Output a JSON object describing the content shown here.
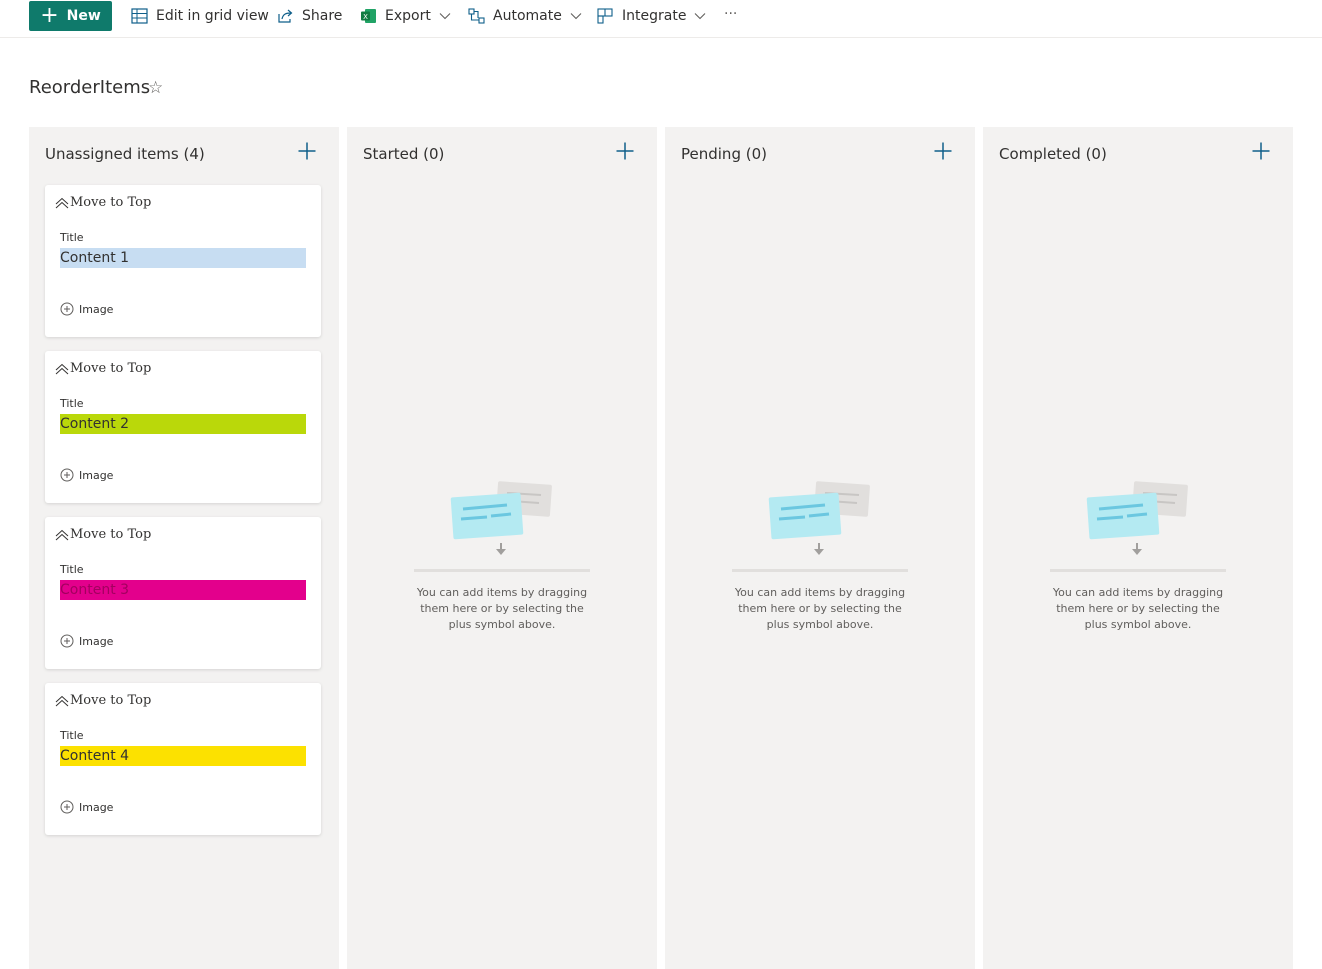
{
  "toolbar": {
    "new_label": "New",
    "edit_grid_label": "Edit in grid view",
    "share_label": "Share",
    "export_label": "Export",
    "automate_label": "Automate",
    "integrate_label": "Integrate",
    "more_label": "···"
  },
  "page": {
    "title": "ReorderItems"
  },
  "board": {
    "columns": [
      {
        "name": "Unassigned items (4)",
        "cards": [
          {
            "move_label": "Move to Top",
            "field_label": "Title",
            "value": "Content 1",
            "color": "#c7ddf2",
            "image_label": "Image"
          },
          {
            "move_label": "Move to Top",
            "field_label": "Title",
            "value": "Content 2",
            "color": "#bad80a",
            "image_label": "Image"
          },
          {
            "move_label": "Move to Top",
            "field_label": "Title",
            "value": "Content 3",
            "color": "#e3008c",
            "image_label": "Image"
          },
          {
            "move_label": "Move to Top",
            "field_label": "Title",
            "value": "Content 4",
            "color": "#fce100",
            "image_label": "Image"
          }
        ]
      },
      {
        "name": "Started (0)",
        "empty_text": "You can add items by dragging them here or by selecting the plus symbol above."
      },
      {
        "name": "Pending (0)",
        "empty_text": "You can add items by dragging them here or by selecting the plus symbol above."
      },
      {
        "name": "Completed (0)",
        "empty_text": "You can add items by dragging them here or by selecting the plus symbol above."
      }
    ]
  },
  "colors": {
    "accent": "#0f7a6b",
    "column_bg": "#f3f2f1",
    "plus_icon": "#0f5f8a"
  }
}
